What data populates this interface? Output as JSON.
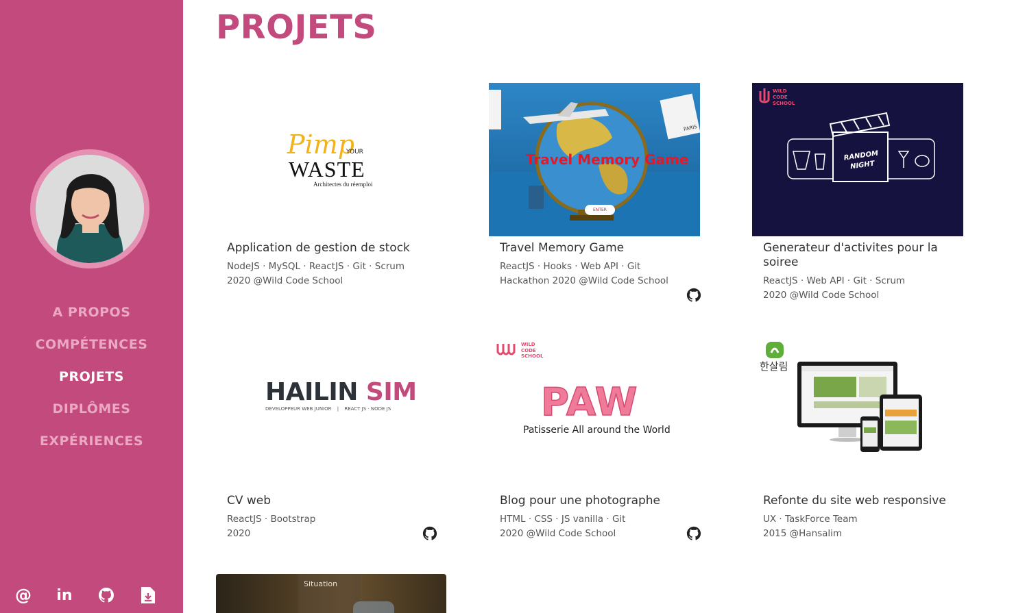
{
  "nav": {
    "items": [
      {
        "label": "A PROPOS",
        "active": false
      },
      {
        "label": "COMPÉTENCES",
        "active": false
      },
      {
        "label": "PROJETS",
        "active": true
      },
      {
        "label": "DIPLÔMES",
        "active": false
      },
      {
        "label": "EXPÉRIENCES",
        "active": false
      }
    ]
  },
  "socials": [
    "email-icon",
    "linkedin-icon",
    "github-icon",
    "download-cv-icon"
  ],
  "socials_labels": {
    "email": "@",
    "linkedin": "in"
  },
  "page": {
    "title": "PROJETS"
  },
  "colors": {
    "accent": "#c24a7c",
    "nav_inactive": "#eaa8c3",
    "text": "#333333"
  },
  "projects": [
    {
      "title": "Application de gestion de stock",
      "tags": "NodeJS · MySQL · ReactJS · Git · Scrum",
      "meta": "2020 @Wild Code School",
      "github": false,
      "logo": {
        "script": "Pimp",
        "small": "YOUR",
        "big": "WASTE",
        "sub": "Architectes du réemploi"
      }
    },
    {
      "title": "Travel Memory Game",
      "tags": "ReactJS · Hooks · Web API · Git",
      "meta": "Hackathon 2020 @Wild Code School",
      "github": true,
      "logo": {
        "headline": "Travel Memory Game",
        "button": "ENTER",
        "postcard": "PARIS"
      }
    },
    {
      "title": "Generateur d'activites pour la soiree",
      "tags": "ReactJS · Web API · Git · Scrum",
      "meta": "2020 @Wild Code School",
      "github": false,
      "logo": {
        "brand": [
          "WILD",
          "CODE",
          "SCHOOL"
        ],
        "sign": [
          "RANDOM",
          "NIGHT"
        ]
      }
    },
    {
      "title": "CV web",
      "tags": "ReactJS · Bootstrap",
      "meta": "2020",
      "github": true,
      "logo": {
        "first": "HAILIN",
        "last": "SIM",
        "sub_left": "DEVELOPPEUR WEB JUNIOR",
        "sep": "|",
        "sub_right": "REACT JS · NODE JS"
      }
    },
    {
      "title": "Blog pour une photographe",
      "tags": "HTML · CSS · JS vanilla · Git",
      "meta": "2020 @Wild Code School",
      "github": true,
      "logo": {
        "brand": [
          "WILD",
          "CODE",
          "SCHOOL"
        ],
        "big": "PAW",
        "sub": "Patisserie All around the World"
      }
    },
    {
      "title": "Refonte du site web responsive",
      "tags": "UX · TaskForce Team",
      "meta": "2015 @Hansalim",
      "github": false,
      "logo": {
        "korean": "한살림"
      }
    },
    {
      "overlay": "Situation"
    }
  ]
}
